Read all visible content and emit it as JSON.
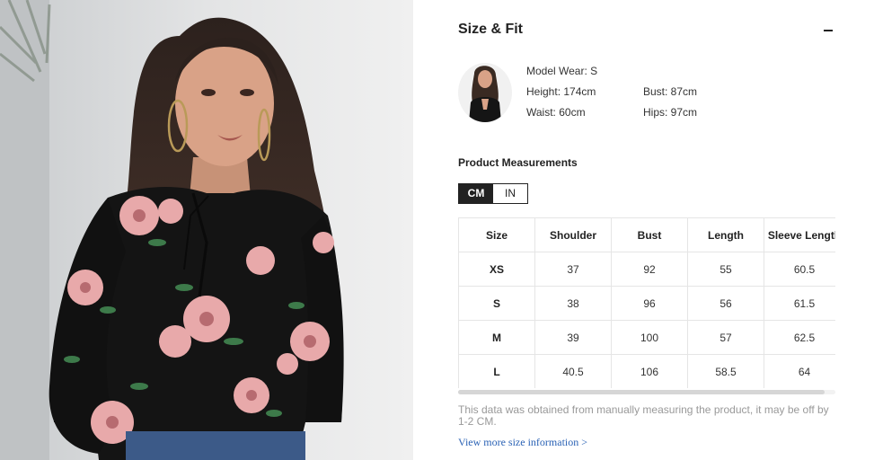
{
  "size_fit": {
    "title": "Size & Fit",
    "model": {
      "wear_label": "Model Wear: S",
      "height": "Height: 174cm",
      "bust": "Bust: 87cm",
      "waist": "Waist: 60cm",
      "hips": "Hips: 97cm"
    },
    "measurements_title": "Product Measurements",
    "units": [
      {
        "label": "CM",
        "active": true
      },
      {
        "label": "IN",
        "active": false
      }
    ],
    "table": {
      "headers": [
        "Size",
        "Shoulder",
        "Bust",
        "Length",
        "Sleeve Length"
      ],
      "rows": [
        [
          "XS",
          "37",
          "92",
          "55",
          "60.5"
        ],
        [
          "S",
          "38",
          "96",
          "56",
          "61.5"
        ],
        [
          "M",
          "39",
          "100",
          "57",
          "62.5"
        ],
        [
          "L",
          "40.5",
          "106",
          "58.5",
          "64"
        ]
      ]
    },
    "note": "This data was obtained from manually measuring the product, it may be off by 1-2 CM.",
    "more_link": "View more size information >"
  },
  "colors": {
    "blouse": "#141414",
    "flower_pink": "#e8a9aa",
    "link": "#2a62b5"
  }
}
